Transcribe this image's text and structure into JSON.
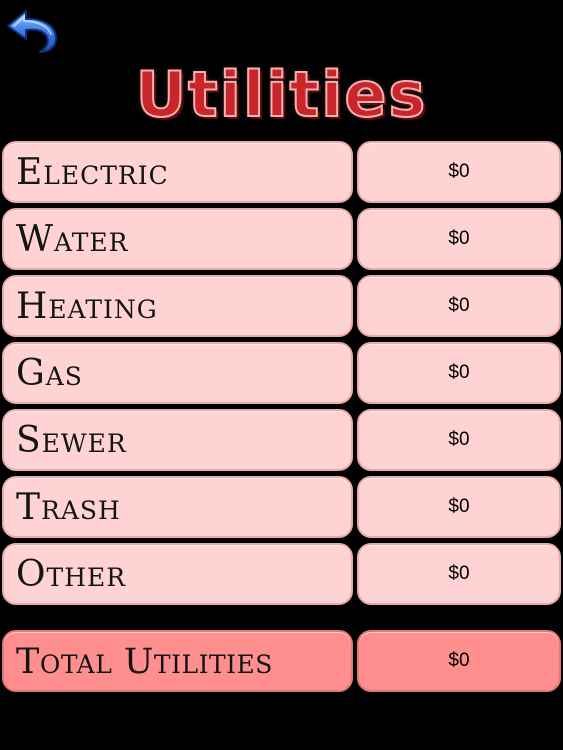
{
  "header": {
    "title": "Utilities"
  },
  "rows": [
    {
      "label": "Electric",
      "value": "$0"
    },
    {
      "label": "Water",
      "value": "$0"
    },
    {
      "label": "Heating",
      "value": "$0"
    },
    {
      "label": "Gas",
      "value": "$0"
    },
    {
      "label": "Sewer",
      "value": "$0"
    },
    {
      "label": "Trash",
      "value": "$0"
    },
    {
      "label": "Other",
      "value": "$0"
    }
  ],
  "total": {
    "label": "Total Utilities",
    "value": "$0"
  },
  "colors": {
    "background": "#000000",
    "row_fill": "#ffd3d3",
    "total_fill": "#ff8f8f",
    "title_red": "#c9262b",
    "back_arrow_blue": "#2f6fd6"
  },
  "icons": {
    "back": "undo-arrow-icon"
  }
}
